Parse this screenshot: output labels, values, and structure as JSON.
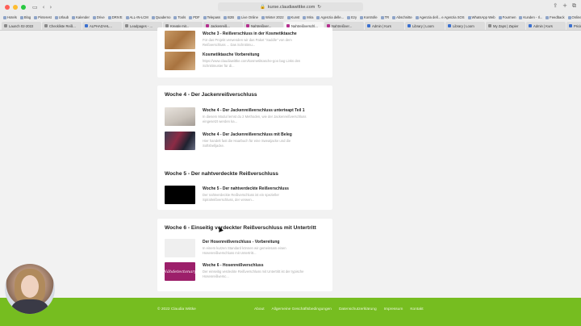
{
  "browser": {
    "back": "‹",
    "forward": "›",
    "sidebar_icon": "▭",
    "url": "kurse.claudiawittke.com",
    "reload": "↻",
    "share": "⇪",
    "new_tab": "+",
    "tabs_overview": "⧉",
    "bookmarks": [
      "Hotels",
      "Blog",
      "Pinterest",
      "Urlaub",
      "Kalender",
      "Drive",
      "DRIVE",
      "ALL-IN-LCM",
      "Quaderno",
      "Tools",
      "PDF",
      "Telepass",
      "B2B",
      "Live Online",
      "Winter 2022",
      "Kunst",
      "Mira",
      "Agenzia delle...",
      "Ezy",
      "Kontrolle",
      "TR",
      "Abschnitte",
      "Agenzia dell... e Agenzia SOS",
      "WhatsApp Web",
      "Fourmen",
      "Kunden - Il...",
      "Feedback",
      "Online - Naht",
      "Schnittmuster"
    ],
    "tabs": [
      {
        "label": "Launch 02-2022",
        "active": false,
        "icon": "gray"
      },
      {
        "label": "Checkliste Reiß...",
        "active": false,
        "icon": "gray"
      },
      {
        "label": "ALPHAZAHL...",
        "active": false,
        "icon": "blue"
      },
      {
        "label": "Leadpages - ...",
        "active": false,
        "icon": "gray"
      },
      {
        "label": "Kreativ mit...",
        "active": false,
        "icon": "gray"
      },
      {
        "label": "Jackenreiß...",
        "active": false,
        "icon": "pink"
      },
      {
        "label": "Nahtreißver...",
        "active": false,
        "icon": "pink"
      },
      {
        "label": "Nahtreißverschl...",
        "active": true,
        "icon": "pink"
      },
      {
        "label": "Nahtreißver...",
        "active": false,
        "icon": "pink"
      },
      {
        "label": "Admin | Kurs",
        "active": false,
        "icon": "blue"
      },
      {
        "label": "Library | Loom",
        "active": false,
        "icon": "blue"
      },
      {
        "label": "Library | Loom",
        "active": false,
        "icon": "blue"
      },
      {
        "label": "My Zaps | Zapier",
        "active": false,
        "icon": "gray"
      },
      {
        "label": "Admin | Kurs",
        "active": false,
        "icon": "blue"
      },
      {
        "label": "Pricing - Kl...",
        "active": false,
        "icon": "blue"
      }
    ]
  },
  "week3_lessons": [
    {
      "title": "Woche 3 - Reißverschluss in der Kosmetiktasche",
      "desc": "Für das Projekt verwenden wir das Paket \"Saddle\" von dem Reißverschluss ... Das Schnittmu..."
    },
    {
      "title": "Kosmetiktasche Vorbereitung",
      "desc": "https://www.claudiawittke.com/kosmetiktasche-goo bag Links den Schnittmuster für di..."
    }
  ],
  "week4": {
    "title": "Woche 4 - Der Jackenreißverschluss",
    "lessons": [
      {
        "title": "Woche 4 - Der Jackenreißverschluss unterteapt Teil 1",
        "desc": "In diesem Modul lernst du 2 Methoden, wie der Jackenreißverschluss eingesetzt werden ka..."
      },
      {
        "title": "Woche 4 - Der Jackenreißverschluss mit Beleg",
        "desc": "Hier handelt fast die Haarbuch für eine Sweatjacke und die Softshelljacke."
      }
    ]
  },
  "week5": {
    "title": "Woche 5 - Der nahtverdeckte Reißverschluss",
    "lessons": [
      {
        "title": "Woche 5 - Der nahtverdeckte Reißverschluss",
        "desc": "Der nahtverdeckte Reißverschluss ist ein spezieller Spiralreißverschluss, der verwen..."
      }
    ]
  },
  "week6": {
    "title": "Woche 6 - Einseitig verdeckter Reißverschluss mit Untertritt",
    "lessons": [
      {
        "title": "Der Hosenreißverschluss - Vorbereitung",
        "desc": "In einem kurzen Standard können wir gemeinsam einen Hosenreißverschluss mit Untertritt..."
      },
      {
        "title": "Woche 6 - Hosenreißverschluss",
        "desc": "Der einseitig verdeckte Reißverschluss mit Untertritt ist der typische Hosenreißversc..."
      }
    ],
    "thumb_text": "Nähdetectonary"
  },
  "footer": {
    "copyright": "© 2022 Claudia Wittke",
    "links": [
      "About",
      "Allgemeine Geschäftsbedingungen",
      "Datenschutzerklärung",
      "Impressum",
      "Kontakt"
    ]
  }
}
